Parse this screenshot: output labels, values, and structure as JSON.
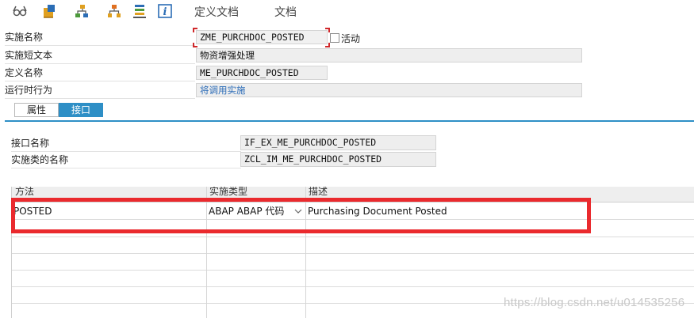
{
  "toolbar": {
    "icons": [
      "glasses-icon",
      "transport-icon",
      "hierarchy-icon",
      "org-chart-icon",
      "stack-icon",
      "info-icon"
    ],
    "menu_definition_doc": "定义文档",
    "menu_documentation": "文档"
  },
  "header": {
    "impl_name_label": "实施名称",
    "impl_name_value": "ZME_PURCHDOC_POSTED",
    "active_label": "活动",
    "impl_short_text_label": "实施短文本",
    "impl_short_text_value": "物资增强处理",
    "def_name_label": "定义名称",
    "def_name_value": "ME_PURCHDOC_POSTED",
    "runtime_label": "运行时行为",
    "runtime_value": "将调用实施"
  },
  "tabs": {
    "attributes": "属性",
    "interface": "接口"
  },
  "interface": {
    "iface_name_label": "接口名称",
    "iface_name_value": "IF_EX_ME_PURCHDOC_POSTED",
    "impl_class_label": "实施类的名称",
    "impl_class_value": "ZCL_IM_ME_PURCHDOC_POSTED"
  },
  "table": {
    "headers": [
      "方法",
      "实施类型",
      "描述"
    ],
    "rows": [
      {
        "method": "POSTED",
        "impl_type": "ABAP ABAP 代码",
        "description": "Purchasing Document Posted"
      }
    ]
  },
  "watermark": "https://blog.csdn.net/u014535256",
  "colors": {
    "accent": "#2e8fc6",
    "highlight": "#ea2a2e",
    "link": "#2a6bb7"
  }
}
